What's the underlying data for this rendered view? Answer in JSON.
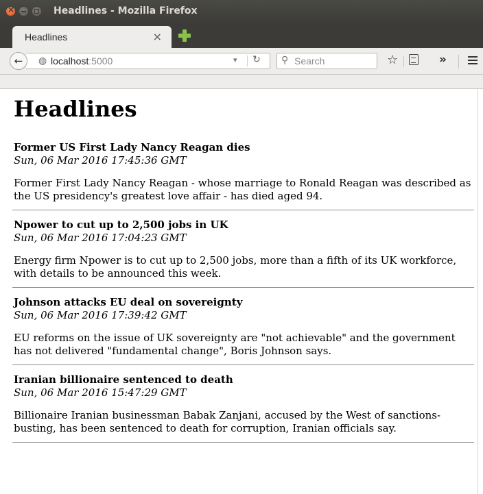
{
  "window": {
    "title": "Headlines - Mozilla Firefox"
  },
  "tab": {
    "label": "Headlines",
    "close_glyph": "×"
  },
  "navbar": {
    "back_glyph": "←",
    "url_host": "localhost",
    "url_port": ":5000",
    "search_placeholder": "Search",
    "overflow_glyph": "»"
  },
  "page": {
    "heading": "Headlines",
    "articles": [
      {
        "title": "Former US First Lady Nancy Reagan dies",
        "date": "Sun, 06 Mar 2016 17:45:36 GMT",
        "summary": "Former First Lady Nancy Reagan - whose marriage to Ronald Reagan was described as the US presidency's greatest love affair - has died aged 94."
      },
      {
        "title": "Npower to cut up to 2,500 jobs in UK",
        "date": "Sun, 06 Mar 2016 17:04:23 GMT",
        "summary": "Energy firm Npower is to cut up to 2,500 jobs, more than a fifth of its UK workforce, with details to be announced this week."
      },
      {
        "title": "Johnson attacks EU deal on sovereignty",
        "date": "Sun, 06 Mar 2016 17:39:42 GMT",
        "summary": "EU reforms on the issue of UK sovereignty are \"not achievable\" and the government has not delivered \"fundamental change\", Boris Johnson says."
      },
      {
        "title": "Iranian billionaire sentenced to death",
        "date": "Sun, 06 Mar 2016 15:47:29 GMT",
        "summary": "Billionaire Iranian businessman Babak Zanjani, accused by the West of sanctions-busting, has been sentenced to death for corruption, Iranian officials say."
      }
    ]
  },
  "icons": {
    "window_close": "close-icon",
    "window_minimize": "minimize-icon",
    "window_maximize": "maximize-icon",
    "new_tab": "plus-icon",
    "back": "back-arrow-icon",
    "site_identity": "globe-icon",
    "url_dropdown": "chevron-down-icon",
    "reload": "reload-icon",
    "search": "search-icon",
    "bookmark": "star-icon",
    "reading_list": "clipboard-icon",
    "overflow": "overflow-icon",
    "menu": "hamburger-menu-icon"
  },
  "colors": {
    "titlebar": "#3c3b37",
    "toolbar": "#eeedeb",
    "close_button": "#e1501a",
    "new_tab_plus": "#8bc34a"
  }
}
